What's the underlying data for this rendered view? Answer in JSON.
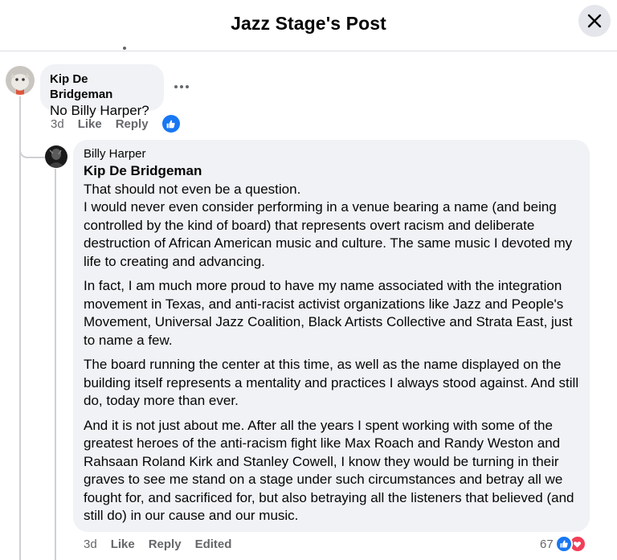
{
  "header": {
    "title": "Jazz Stage's Post",
    "close_icon": "close-icon"
  },
  "comment": {
    "author": "Kip De Bridgeman",
    "text": "No Billy Harper?",
    "meta": {
      "time": "3d",
      "like": "Like",
      "reply": "Reply"
    },
    "reaction_icon": "like-icon"
  },
  "reply": {
    "author": "Billy Harper",
    "mention": "Kip De Bridgeman",
    "paragraphs": [
      "That should not even be a question.\nI would never even consider performing in a venue bearing a name (and being controlled by the kind of board) that represents overt racism and deliberate destruction of African American music and culture. The same music I devoted my life to creating and advancing.",
      "In fact, I am much more proud to have my name associated with the integration movement in Texas, and anti-racist activist organizations like Jazz and People's Movement, Universal Jazz Coalition, Black Artists Collective and Strata East, just to name a few.",
      "The board running the center at this time, as well as the name displayed on the building itself represents a mentality and practices I always stood against. And still do, today more than ever.",
      "And it is not just about me. After all the years I spent working with some of the greatest heroes of the anti-racism fight like Max Roach and Randy Weston and Rahsaan Roland Kirk and Stanley Cowell, I know they would be turning in their graves to see me stand on a stage under such circumstances and betray all we fought for, and sacrificed for, but also betraying all the listeners that believed (and still do) in our cause and our music."
    ],
    "meta": {
      "time": "3d",
      "like": "Like",
      "reply": "Reply",
      "edited": "Edited"
    },
    "reactions": {
      "count": "67",
      "icons": [
        "like-icon",
        "love-icon"
      ]
    }
  },
  "colors": {
    "accent": "#1877f2",
    "love": "#f33e58",
    "bubble": "#f0f2f5",
    "meta_text": "#65676b"
  }
}
